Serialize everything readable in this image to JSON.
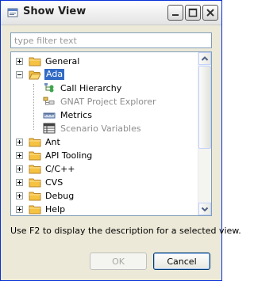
{
  "window": {
    "title": "Show View"
  },
  "filter": {
    "placeholder": "type filter text",
    "value": ""
  },
  "tree": {
    "items": [
      {
        "label": "General",
        "state": "collapsed"
      },
      {
        "label": "Ada",
        "state": "expanded",
        "selected": true,
        "children": [
          {
            "label": "Call Hierarchy",
            "enabled": true
          },
          {
            "label": "GNAT Project Explorer",
            "enabled": false
          },
          {
            "label": "Metrics",
            "enabled": true
          },
          {
            "label": "Scenario Variables",
            "enabled": false
          }
        ]
      },
      {
        "label": "Ant",
        "state": "collapsed"
      },
      {
        "label": "API Tooling",
        "state": "collapsed"
      },
      {
        "label": "C/C++",
        "state": "collapsed"
      },
      {
        "label": "CVS",
        "state": "collapsed"
      },
      {
        "label": "Debug",
        "state": "collapsed"
      },
      {
        "label": "Help",
        "state": "collapsed"
      }
    ]
  },
  "hint": "Use F2 to display the description for a selected view.",
  "buttons": {
    "ok": "OK",
    "cancel": "Cancel"
  },
  "colors": {
    "selection": "#316ac5",
    "folder": "#f5c242",
    "dialog_bg": "#ece9d8"
  }
}
